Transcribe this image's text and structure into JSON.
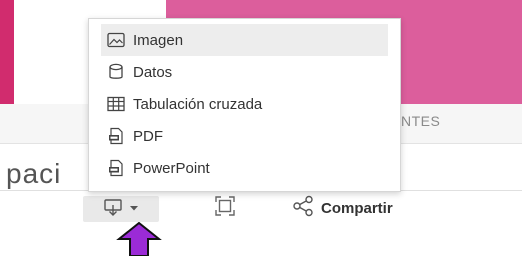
{
  "background": {
    "partial_column_header": "NTES",
    "partial_title": "paci"
  },
  "menu": {
    "items": [
      {
        "label": "Imagen",
        "icon": "image-icon"
      },
      {
        "label": "Datos",
        "icon": "database-icon"
      },
      {
        "label": "Tabulación cruzada",
        "icon": "table-icon"
      },
      {
        "label": "PDF",
        "icon": "pdf-file-icon"
      },
      {
        "label": "PowerPoint",
        "icon": "ppt-file-icon"
      }
    ],
    "highlighted_item": "Imagen"
  },
  "toolbar": {
    "download_icon": "download-icon",
    "fit_icon": "fit-to-screen-icon",
    "share_icon": "share-icon",
    "share_label": "Compartir"
  },
  "colors": {
    "accent_pink": "#dc5e9c",
    "accent_magenta": "#d12c6e",
    "annotation_arrow": "#9b2bd6",
    "menu_highlight": "#ededed"
  }
}
